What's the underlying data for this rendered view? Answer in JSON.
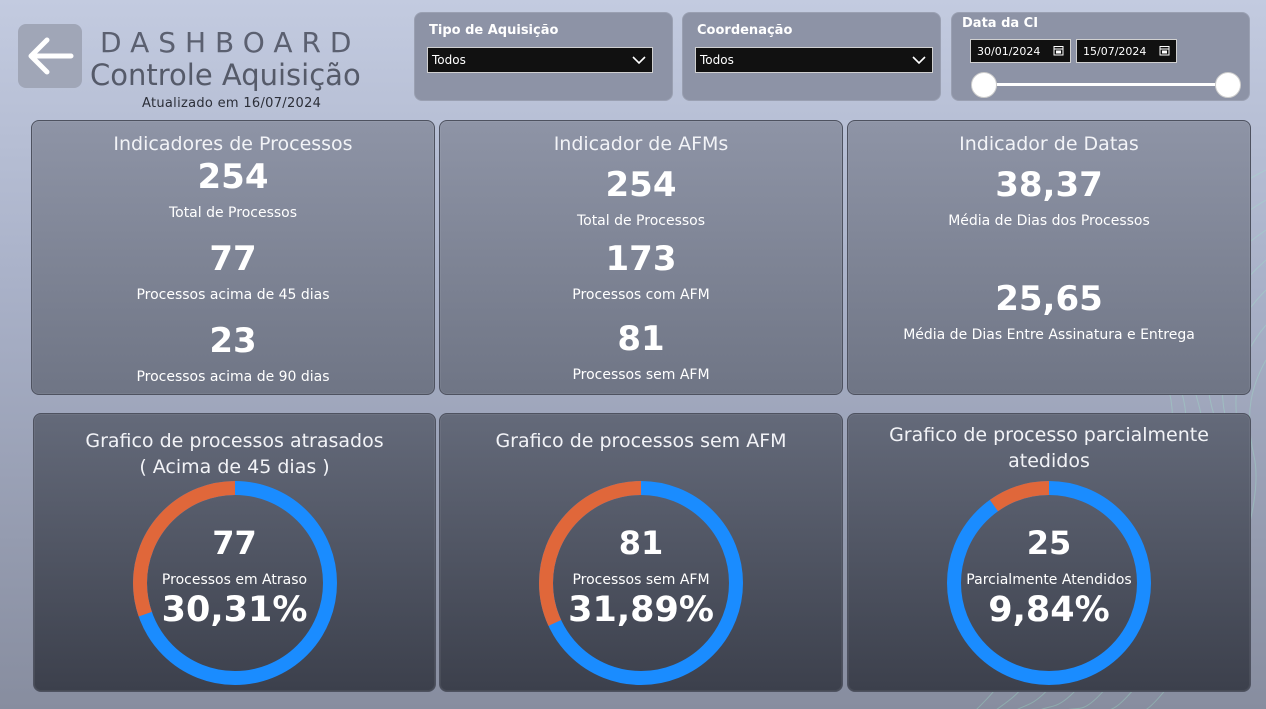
{
  "header": {
    "title_line1": "DASHBOARD",
    "title_line2": "Controle Aquisição",
    "updated": "Atualizado em 16/07/2024",
    "back_icon": "arrow-left-icon"
  },
  "filters": {
    "tipo_aquisicao": {
      "label": "Tipo de Aquisição",
      "value": "Todos"
    },
    "coordenacao": {
      "label": "Coordenação",
      "value": "Todos"
    },
    "data_ci": {
      "label": "Data da CI",
      "start": "30/01/2024",
      "end": "15/07/2024"
    }
  },
  "indicadores_processos": {
    "title": "Indicadores de Processos",
    "items": [
      {
        "value": "254",
        "label": "Total de Processos"
      },
      {
        "value": "77",
        "label": "Processos acima de 45 dias"
      },
      {
        "value": "23",
        "label": "Processos acima de 90 dias"
      }
    ]
  },
  "indicador_afms": {
    "title": "Indicador de AFMs",
    "items": [
      {
        "value": "254",
        "label": "Total de Processos"
      },
      {
        "value": "173",
        "label": "Processos com AFM"
      },
      {
        "value": "81",
        "label": "Processos sem AFM"
      }
    ]
  },
  "indicador_datas": {
    "title": "Indicador de Datas",
    "items": [
      {
        "value": "38,37",
        "label": "Média de Dias dos Processos"
      },
      {
        "value": "25,65",
        "label": "Média de Dias Entre Assinatura e Entrega"
      }
    ]
  },
  "charts": {
    "atrasados": {
      "title_line1": "Grafico de processos atrasados",
      "title_line2": "( Acima de 45 dias )",
      "value": "77",
      "label": "Processos em Atraso",
      "percent": "30,31%",
      "fraction": 0.3031
    },
    "sem_afm": {
      "title_line1": "Grafico de processos sem AFM",
      "title_line2": "",
      "value": "81",
      "label": "Processos sem AFM",
      "percent": "31,89%",
      "fraction": 0.3189
    },
    "parcial": {
      "title_line1": "Grafico de processo parcialmente",
      "title_line2": "atedidos",
      "value": "25",
      "label": "Parcialmente Atendidos",
      "percent": "9,84%",
      "fraction": 0.0984
    }
  },
  "colors": {
    "donut_main": "#1a8cff",
    "donut_accent": "#e0673a"
  }
}
